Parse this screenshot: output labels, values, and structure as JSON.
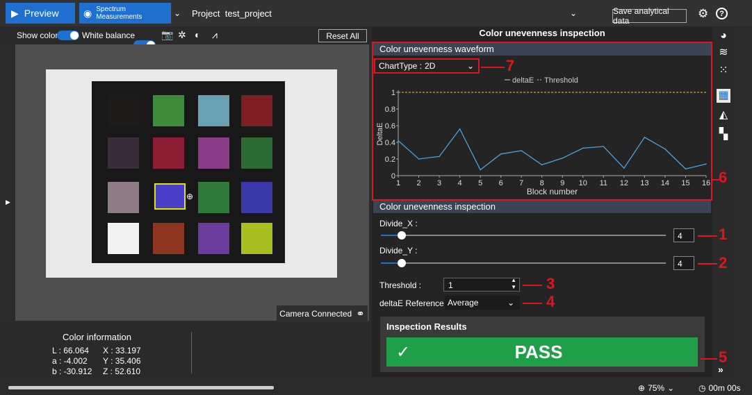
{
  "topbar": {
    "preview_label": "Preview",
    "spectrum_label_1": "Spectrum",
    "spectrum_label_2": "Measurements",
    "project_label": "Project",
    "project_name": "test_project",
    "save_label": "Save analytical data",
    "gear_icon": "gear-icon",
    "help_icon": "help-icon"
  },
  "toolbar": {
    "show_color": "Show color",
    "white_balance": "White balance",
    "reset_label": "Reset All"
  },
  "camera": {
    "status": "Camera Connected"
  },
  "color_info": {
    "title": "Color information",
    "L": "L : 66.064",
    "a": "a : -4.002",
    "b": "b : -30.912",
    "X": "X : 33.197",
    "Y": "Y : 35.406",
    "Z": "Z : 52.610"
  },
  "panel": {
    "title": "Color unevenness inspection",
    "waveform_title": "Color unevenness waveform",
    "charttype_label": "ChartType :",
    "charttype_value": "2D",
    "inspection_title": "Color unevenness inspection",
    "divide_x_label": "Divide_X :",
    "divide_x_value": "4",
    "divide_y_label": "Divide_Y :",
    "divide_y_value": "4",
    "threshold_label": "Threshold :",
    "threshold_value": "1",
    "deltae_label": "deltaE Reference :",
    "deltae_value": "Average",
    "results_title": "Inspection Results",
    "result": "PASS"
  },
  "annotations": [
    "1",
    "2",
    "3",
    "4",
    "5",
    "6",
    "7"
  ],
  "status": {
    "zoom": "75%",
    "timer": "00m 00s"
  },
  "chart_data": {
    "type": "line",
    "x": [
      1,
      2,
      3,
      4,
      5,
      6,
      7,
      8,
      9,
      10,
      11,
      12,
      13,
      14,
      15,
      16
    ],
    "series": [
      {
        "name": "deltaE",
        "values": [
          0.42,
          0.2,
          0.23,
          0.56,
          0.07,
          0.26,
          0.3,
          0.13,
          0.21,
          0.33,
          0.35,
          0.09,
          0.46,
          0.32,
          0.08,
          0.14
        ]
      },
      {
        "name": "Threshold",
        "values": [
          1,
          1,
          1,
          1,
          1,
          1,
          1,
          1,
          1,
          1,
          1,
          1,
          1,
          1,
          1,
          1
        ]
      }
    ],
    "xlabel": "Block number",
    "ylabel": "DeltaE",
    "ylim": [
      0,
      1
    ],
    "yticks": [
      "0",
      "0.2",
      "0.4",
      "0.6",
      "0.8",
      "1"
    ],
    "xticks": [
      "1",
      "2",
      "3",
      "4",
      "5",
      "6",
      "7",
      "8",
      "9",
      "10",
      "11",
      "12",
      "13",
      "14",
      "15",
      "16"
    ],
    "colors": {
      "deltaE": "#4aa3df",
      "Threshold": "#e09a2c"
    }
  },
  "patch_colors": [
    "#1f1a1a",
    "#3f8a3b",
    "#6aa0b3",
    "#7e1e22",
    "#3a2c3a",
    "#8b1e34",
    "#8b3c8a",
    "#2c6b31",
    "#8d7b86",
    "#4a3fc9",
    "#2e7a39",
    "#3a37a8",
    "#f2f2f2",
    "#8e3522",
    "#6a3b9a",
    "#a8bf1f"
  ]
}
